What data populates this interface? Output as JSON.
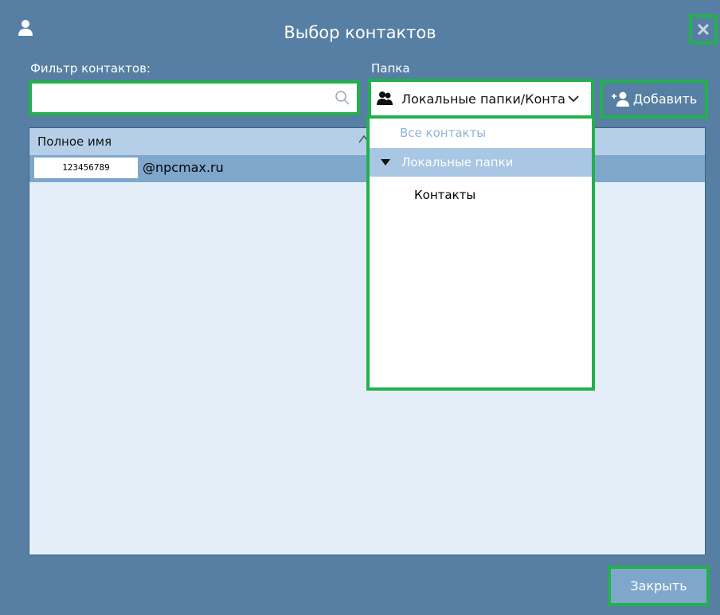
{
  "window": {
    "title": "Выбор контактов",
    "icon": "person-icon"
  },
  "filter": {
    "label": "Фильтр контактов:",
    "value": "",
    "placeholder": ""
  },
  "folder": {
    "label": "Папка",
    "selected": "Локальные папки/Контакты"
  },
  "toolbar": {
    "add_label": "Добавить"
  },
  "list": {
    "columns": [
      "Полное имя"
    ],
    "rows": [
      {
        "name_prefix": "123456789",
        "email": "@npcmax.ru"
      }
    ]
  },
  "dropdown": {
    "items": [
      {
        "label": "Все контакты"
      },
      {
        "label": "Локальные папки"
      },
      {
        "label": "Контакты"
      }
    ]
  },
  "footer": {
    "close_label": "Закрыть"
  },
  "colors": {
    "background": "#567fa3",
    "highlight": "#22b14c",
    "header": "#b6cfe8",
    "selected_row": "#7fa7cc"
  }
}
